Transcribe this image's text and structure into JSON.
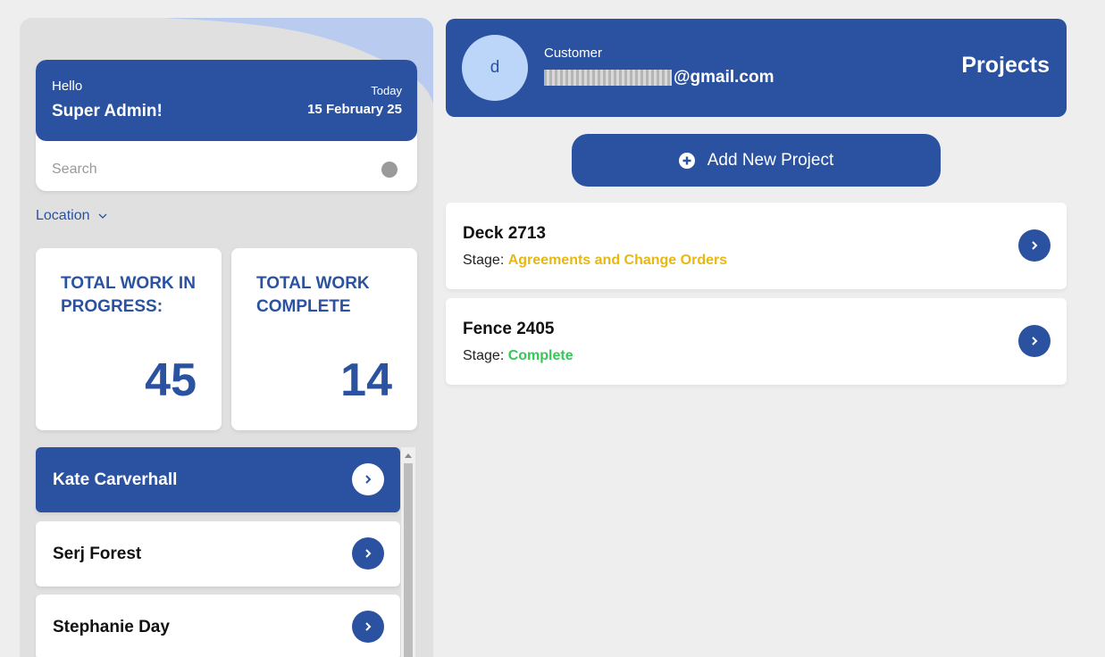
{
  "colors": {
    "primary": "#2b52a0",
    "stage_agreements": "#e8b80e",
    "stage_complete": "#32c956"
  },
  "greeting": {
    "hello": "Hello",
    "name": "Super Admin!",
    "today_label": "Today",
    "date": "15 February 25"
  },
  "search": {
    "placeholder": "Search",
    "icon": "search-icon"
  },
  "location": {
    "label": "Location",
    "icon": "chevron-down-icon"
  },
  "stats": {
    "wip_label": "TOTAL WORK IN PROGRESS:",
    "wip_value": "45",
    "complete_label": "TOTAL WORK COMPLETE",
    "complete_value": "14"
  },
  "users": [
    {
      "name": "Kate Carverhall",
      "active": true
    },
    {
      "name": "Serj Forest",
      "active": false
    },
    {
      "name": "Stephanie Day",
      "active": false
    }
  ],
  "header": {
    "avatar_initial": "d",
    "role": "Customer",
    "email_domain": "@gmail.com",
    "title": "Projects"
  },
  "add_project": {
    "label": "Add New Project",
    "icon": "plus-circle-icon"
  },
  "projects": [
    {
      "name": "Deck 2713",
      "stage_label": "Stage:",
      "stage": "Agreements and Change Orders",
      "stage_color": "#e8b80e"
    },
    {
      "name": "Fence 2405",
      "stage_label": "Stage:",
      "stage": "Complete",
      "stage_color": "#32c956"
    }
  ]
}
